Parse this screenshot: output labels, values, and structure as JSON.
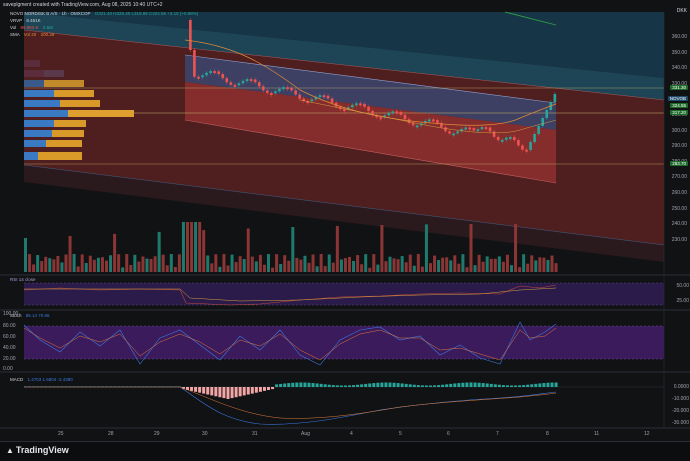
{
  "header": {
    "attribution": "saveplgment created with TradingView.com, Aug 08, 2025 10:40 UTC+2"
  },
  "instrument": {
    "title": "NOVO NORDISK B A/S · 1h · OMXCOP",
    "ohlc": "O321.40 H325.40 L319.95 C324.55 +3.15 (+0.98%)"
  },
  "indicators_legend": {
    "vrvp": "VRVP",
    "vrvp_value": "8.451K",
    "vol": "Vol",
    "vol_value": "99.964 K",
    "vol_value2": "2.5M",
    "sma": "SMA",
    "sma_value": "Vol 20",
    "sma_value2": "200.28"
  },
  "price_axis": {
    "currency": "DKK",
    "ticks": [
      "360.00",
      "350.00",
      "340.00",
      "330.00",
      "320.00",
      "310.00",
      "300.00",
      "290.00",
      "280.00",
      "270.00",
      "260.00",
      "250.00",
      "240.00",
      "230.00"
    ]
  },
  "price_tags": [
    {
      "label": "331.30",
      "color": "#1f6b2c"
    },
    {
      "label": "NOVOB",
      "color": "#1f4a6b"
    },
    {
      "label": "324.55",
      "color": "#1f6b2c"
    },
    {
      "label": "317.20",
      "color": "#1f6b2c"
    },
    {
      "label": "283.70",
      "color": "#1f6b2c"
    }
  ],
  "rsi_panel": {
    "label": "RSI 14 close",
    "ticks": [
      "50.00",
      "25.00"
    ]
  },
  "stoch_panel": {
    "label": "Stoch",
    "values": "85.14  70.66",
    "ticks": [
      "100.00",
      "80.00",
      "60.00",
      "40.00",
      "20.00",
      "0.00"
    ]
  },
  "macd_panel": {
    "label": "MACD",
    "values": "1.4703  1.6804  -2.4390",
    "ticks": [
      "0.0000",
      "-10.000",
      "-20.000",
      "-30.000"
    ]
  },
  "x_axis": {
    "ticks": [
      "25",
      "28",
      "29",
      "30",
      "31",
      "Aug",
      "4",
      "5",
      "6",
      "7",
      "8",
      "11",
      "12"
    ]
  },
  "footer": {
    "brand": "TradingView"
  },
  "colors": {
    "up": "#26a69a",
    "down": "#ef5350",
    "channel_fill": "#7a2a2a",
    "upper_channel": "#1e3a4a",
    "rsi_bg": "#2b1b4a",
    "stoch_bg": "#3b1b5c"
  }
}
